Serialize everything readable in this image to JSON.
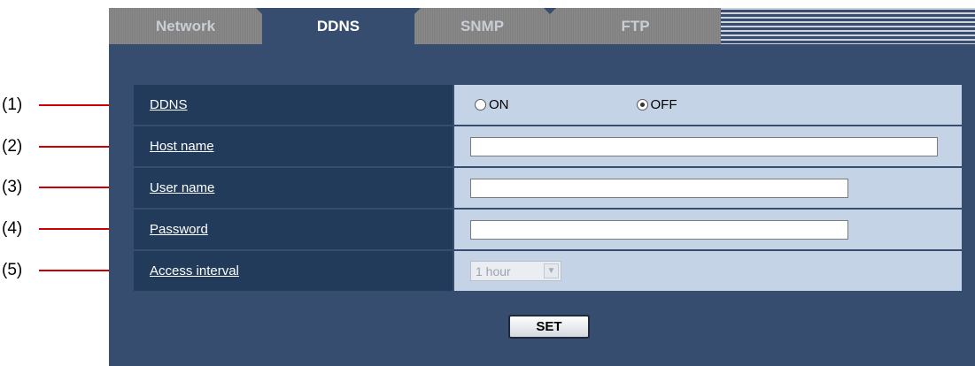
{
  "tabs": {
    "network": "Network",
    "ddns": "DDNS",
    "snmp": "SNMP",
    "ftp": "FTP",
    "active": "DDNS"
  },
  "callouts": [
    "(1)",
    "(2)",
    "(3)",
    "(4)",
    "(5)"
  ],
  "form": {
    "ddns": {
      "label": "DDNS",
      "on_label": "ON",
      "off_label": "OFF",
      "selected": "OFF"
    },
    "host_name": {
      "label": "Host name",
      "value": ""
    },
    "user_name": {
      "label": "User name",
      "value": ""
    },
    "password": {
      "label": "Password",
      "value": ""
    },
    "access_interval": {
      "label": "Access interval",
      "value": "1 hour",
      "disabled": true
    }
  },
  "set_button": "SET",
  "colors": {
    "callout_line": "#cc0000",
    "panel_bg": "#364d6f",
    "label_bg": "#233b5a",
    "value_bg": "#c4d3e6"
  },
  "icons": {
    "dropdown": "chevron-down-icon"
  }
}
